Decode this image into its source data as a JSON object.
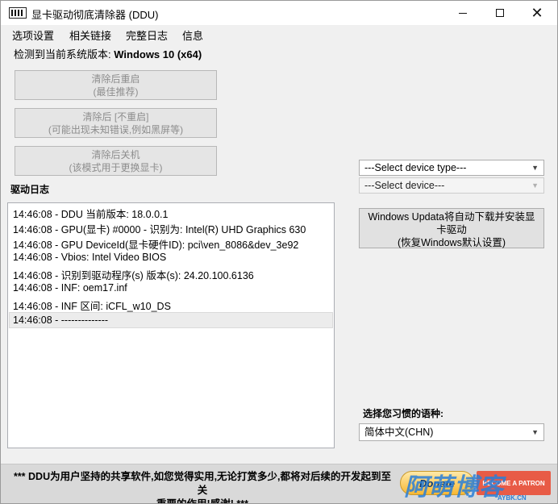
{
  "window": {
    "title": "显卡驱动彻底清除器 (DDU)",
    "controls": {
      "minimize": "minimize",
      "maximize": "maximize",
      "close": "close"
    }
  },
  "menu": [
    "选项设置",
    "相关链接",
    "完整日志",
    "信息"
  ],
  "detected": {
    "label": "检测到当前系统版本: ",
    "value": "Windows 10 (x64)"
  },
  "actions": [
    {
      "line1": "清除后重启",
      "line2": "(最佳推荐)"
    },
    {
      "line1": "清除后 [不重启]",
      "line2": "(可能出现未知错误,例如黑屏等)"
    },
    {
      "line1": "清除后关机",
      "line2": "(该模式用于更换显卡)"
    }
  ],
  "log": {
    "label": "驱动日志",
    "lines": [
      "14:46:08 - DDU 当前版本: 18.0.0.1",
      "14:46:08 - GPU(显卡) #0000 - 识别为: Intel(R) UHD Graphics 630",
      "14:46:08 - GPU DeviceId(显卡硬件ID): pci\\ven_8086&dev_3e92",
      "14:46:08 - Vbios: Intel Video BIOS",
      "14:46:08 - 识别到驱动程序(s) 版本(s): 24.20.100.6136",
      "14:46:08 - INF: oem17.inf",
      "14:46:08 - INF 区间: iCFL_w10_DS",
      "14:46:08 - --------------"
    ]
  },
  "device_type": {
    "value": "---Select device type---"
  },
  "device": {
    "value": "---Select device---"
  },
  "windows_update": {
    "line1": "Windows Updata将自动下载并安装显",
    "line2": "卡驱动",
    "line3": "(恢复Windows默认设置)"
  },
  "language": {
    "label": "选择您习惯的语种:",
    "value": "简体中文(CHN)"
  },
  "footer": {
    "line1": "*** DDU为用户坚持的共享软件,如您觉得实用,无论打赏多少,都将对后续的开发起到至关",
    "line2": "重要的作用!感谢! ***",
    "donate": "Donate",
    "patreon": "BECOME A PATRON"
  },
  "watermark": {
    "main": "阿萌博客",
    "sub": "AYBK.CN"
  },
  "icons": {
    "app": "ddu-app-icon",
    "caret": "chevron-down-icon"
  },
  "colors": {
    "window_bg": "#f0f0f0",
    "watermark": "#2a7fd8",
    "patreon": "#e85b46"
  }
}
